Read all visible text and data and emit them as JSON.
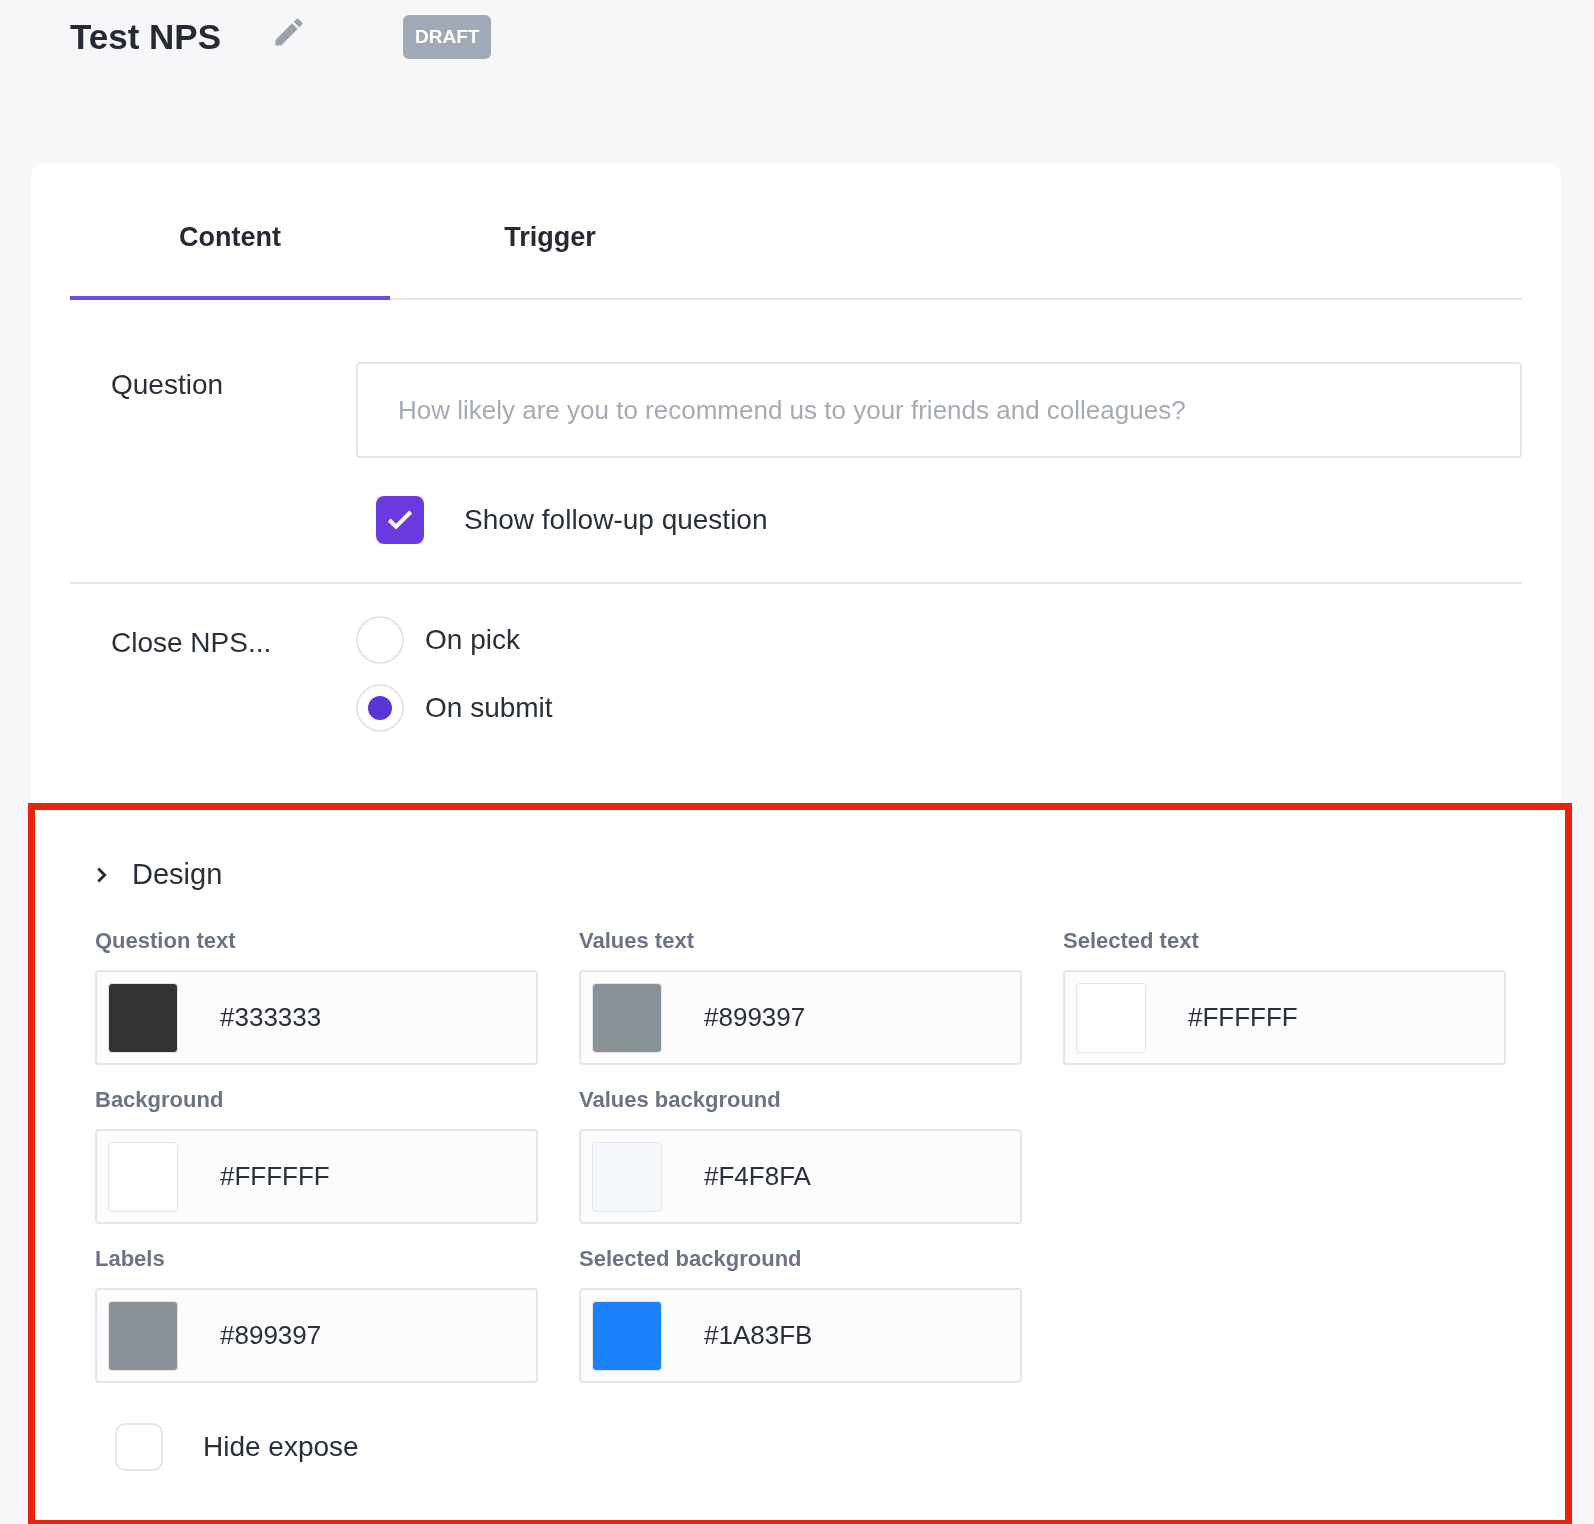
{
  "header": {
    "title": "Test NPS",
    "badge": "DRAFT"
  },
  "tabs": [
    {
      "label": "Content",
      "selected": true
    },
    {
      "label": "Trigger",
      "selected": false
    }
  ],
  "question": {
    "label": "Question",
    "placeholder": "How likely are you to recommend us to your friends and colleagues?",
    "follow_up": {
      "label": "Show follow-up question",
      "checked": true
    }
  },
  "close": {
    "label": "Close NPS...",
    "options": [
      {
        "label": "On pick",
        "selected": false
      },
      {
        "label": "On submit",
        "selected": true
      }
    ]
  },
  "design": {
    "title": "Design",
    "expanded": false,
    "rows": [
      [
        {
          "label": "Question text",
          "value": "#333333",
          "color": "#333333"
        },
        {
          "label": "Values text",
          "value": "#899397",
          "color": "#899397"
        },
        {
          "label": "Selected text",
          "value": "#FFFFFF",
          "color": "#ffffff"
        }
      ],
      [
        {
          "label": "Background",
          "value": "#FFFFFF",
          "color": "#ffffff"
        },
        {
          "label": "Values background",
          "value": "#F4F8FA",
          "color": "#f4f8fa"
        }
      ],
      [
        {
          "label": "Labels",
          "value": "#899397",
          "color": "#899397"
        },
        {
          "label": "Selected background",
          "value": "#1A83FB",
          "color": "#1a83fb"
        }
      ]
    ],
    "hide_expose": {
      "label": "Hide expose",
      "checked": false
    }
  }
}
